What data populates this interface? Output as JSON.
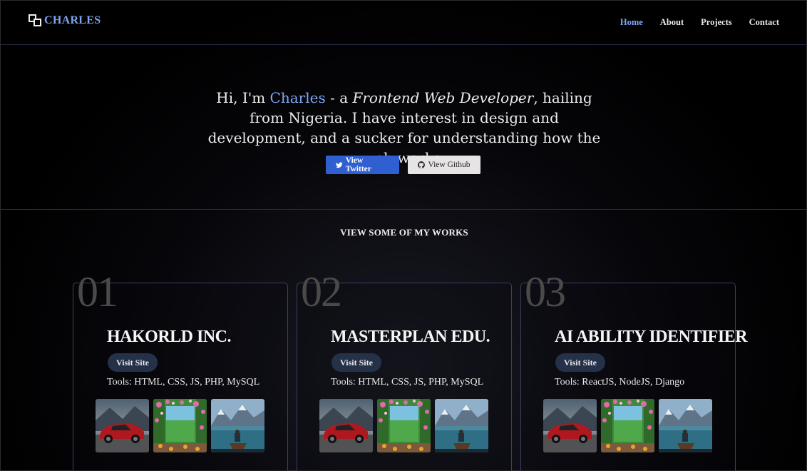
{
  "nav": {
    "logo": "CHARLES",
    "links": [
      "Home",
      "About",
      "Projects",
      "Contact"
    ],
    "active": "Home"
  },
  "hero": {
    "greet_pre": "Hi, I'm ",
    "name": "Charles",
    "dash": " - a ",
    "role": "Frontend Web Developer",
    "rest": ", hailing from Nigeria. I have interest in design and development, and a sucker for understanding how the web works.",
    "twitter_label": "View Twitter",
    "github_label": "View Github"
  },
  "works": {
    "heading": "VIEW SOME OF MY WORKS",
    "visit_label": "Visit Site",
    "projects": [
      {
        "number": "01",
        "title": "HAKORLD INC.",
        "tools": "Tools: HTML, CSS, JS, PHP, MySQL"
      },
      {
        "number": "02",
        "title": "MASTERPLAN EDU.",
        "tools": "Tools: HTML, CSS, JS, PHP, MySQL"
      },
      {
        "number": "03",
        "title": "AI ABILITY IDENTIFIER",
        "tools": "Tools: ReactJS, NodeJS, Django"
      }
    ],
    "thumbnails": [
      "red-sports-car-image",
      "flower-garden-image",
      "mountain-lake-boat-image"
    ]
  },
  "colors": {
    "accent": "#7ea6f2",
    "twitter_button": "#2f5fd0",
    "github_button": "#e6e4e4",
    "visit_button": "#253149",
    "card_border": "#3a3f6a"
  }
}
